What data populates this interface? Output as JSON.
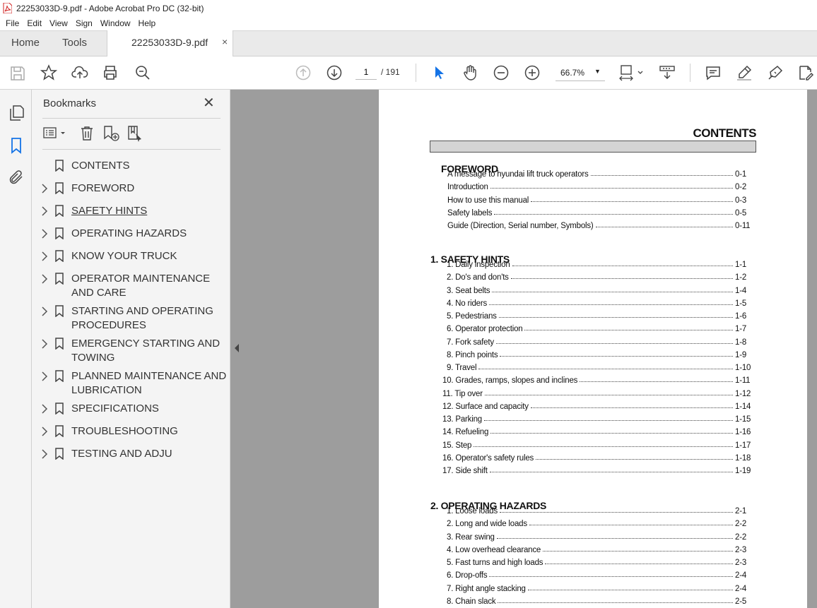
{
  "window": {
    "title": "22253033D-9.pdf - Adobe Acrobat Pro DC (32-bit)"
  },
  "menu": [
    "File",
    "Edit",
    "View",
    "Sign",
    "Window",
    "Help"
  ],
  "tabs": {
    "home": "Home",
    "tools": "Tools",
    "doc": "22253033D-9.pdf",
    "close": "×"
  },
  "toolbar": {
    "page_current": "1",
    "page_total": "/  191",
    "zoom": "66.7%"
  },
  "bookmarks": {
    "title": "Bookmarks",
    "items": [
      {
        "label": "CONTENTS",
        "expandable": false
      },
      {
        "label": "FOREWORD",
        "expandable": true
      },
      {
        "label": "SAFETY HINTS",
        "expandable": true,
        "selected": true
      },
      {
        "label": "OPERATING HAZARDS",
        "expandable": true
      },
      {
        "label": "KNOW YOUR TRUCK",
        "expandable": true
      },
      {
        "label": "OPERATOR MAINTENANCE AND CARE",
        "expandable": true
      },
      {
        "label": "STARTING AND OPERATING PROCEDURES",
        "expandable": true
      },
      {
        "label": "EMERGENCY STARTING AND TOWING",
        "expandable": true
      },
      {
        "label": "PLANNED MAINTENANCE AND LUBRICATION",
        "expandable": true
      },
      {
        "label": "SPECIFICATIONS",
        "expandable": true
      },
      {
        "label": "TROUBLESHOOTING",
        "expandable": true
      },
      {
        "label": "TESTING AND ADJU",
        "expandable": true
      }
    ]
  },
  "document": {
    "heading": "CONTENTS",
    "sections": [
      {
        "title": "FOREWORD",
        "entries": [
          {
            "text": "A message to hyundai lift truck operators",
            "page": "0-1"
          },
          {
            "text": "Introduction",
            "page": "0-2"
          },
          {
            "text": "How to use this manual",
            "page": "0-3"
          },
          {
            "text": "Safety labels",
            "page": "0-5"
          },
          {
            "text": "Guide (Direction, Serial number, Symbols)",
            "page": "0-11"
          }
        ]
      },
      {
        "title": "1. SAFETY HINTS",
        "entries": [
          {
            "text": "1. Daily inspection",
            "page": "1-1"
          },
          {
            "text": "2. Do's and don'ts",
            "page": "1-2"
          },
          {
            "text": "3. Seat belts",
            "page": "1-4"
          },
          {
            "text": "4. No riders",
            "page": "1-5"
          },
          {
            "text": "5. Pedestrians",
            "page": "1-6"
          },
          {
            "text": "6. Operator protection",
            "page": "1-7"
          },
          {
            "text": "7.  Fork safety",
            "page": "1-8"
          },
          {
            "text": "8.  Pinch points",
            "page": "1-9"
          },
          {
            "text": "9. Travel",
            "page": "1-10"
          },
          {
            "text": "10. Grades, ramps, slopes and inclines",
            "page": "1-11"
          },
          {
            "text": "11. Tip over",
            "page": "1-12"
          },
          {
            "text": "12. Surface and capacity",
            "page": "1-14"
          },
          {
            "text": "13. Parking",
            "page": "1-15"
          },
          {
            "text": "14. Refueling",
            "page": "1-16"
          },
          {
            "text": "15. Step",
            "page": "1-17"
          },
          {
            "text": "16. Operator's safety rules",
            "page": "1-18"
          },
          {
            "text": "17. Side shift",
            "page": "1-19"
          }
        ]
      },
      {
        "title": "2. OPERATING HAZARDS",
        "entries": [
          {
            "text": "1. Loose loads",
            "page": "2-1"
          },
          {
            "text": "2. Long and wide loads",
            "page": "2-2"
          },
          {
            "text": "3. Rear swing",
            "page": "2-2"
          },
          {
            "text": "4. Low overhead clearance",
            "page": "2-3"
          },
          {
            "text": "5. Fast turns and high loads",
            "page": "2-3"
          },
          {
            "text": "6. Drop-offs",
            "page": "2-4"
          },
          {
            "text": "7. Right angle stacking",
            "page": "2-4"
          },
          {
            "text": "8. Chain slack",
            "page": "2-5"
          }
        ]
      }
    ]
  },
  "colors": {
    "accent": "#1473e6",
    "viewer_bg": "#9d9d9d",
    "panel_bg": "#f4f4f4"
  }
}
